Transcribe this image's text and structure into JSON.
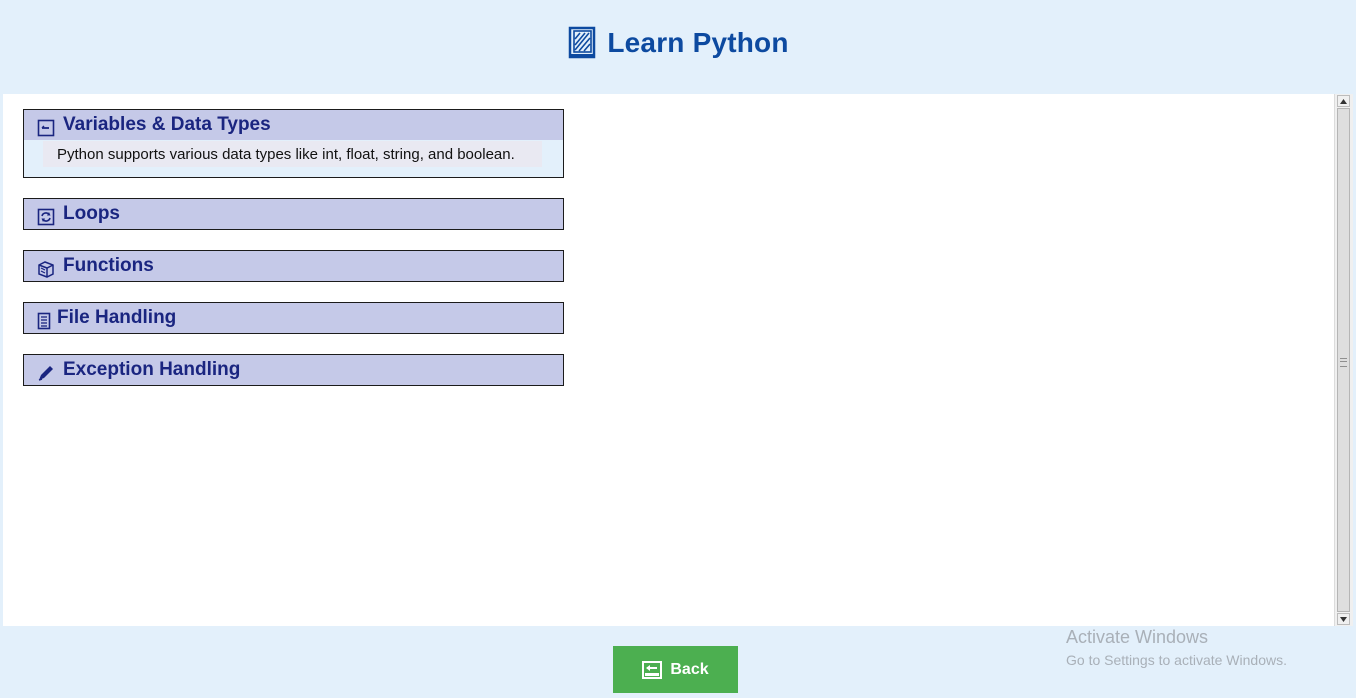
{
  "header": {
    "title": "Learn Python",
    "icon": "book-icon"
  },
  "sections": [
    {
      "label": "Variables & Data Types",
      "icon": "collapse-icon",
      "expanded": true,
      "description": "Python supports various data types like int, float, string, and boolean."
    },
    {
      "label": "Loops",
      "icon": "loop-icon",
      "expanded": false
    },
    {
      "label": "Functions",
      "icon": "cube-icon",
      "expanded": false
    },
    {
      "label": "File Handling",
      "icon": "document-icon",
      "expanded": false
    },
    {
      "label": "Exception Handling",
      "icon": "pen-icon",
      "expanded": false
    }
  ],
  "footer": {
    "back_label": "Back"
  },
  "watermark": {
    "line1": "Activate Windows",
    "line2": "Go to Settings to activate Windows."
  },
  "colors": {
    "header_bg": "#e3f0fb",
    "title": "#0d4aa0",
    "section_bg": "#c5c9e8",
    "section_label": "#1a2580",
    "back_button": "#4caf50"
  }
}
